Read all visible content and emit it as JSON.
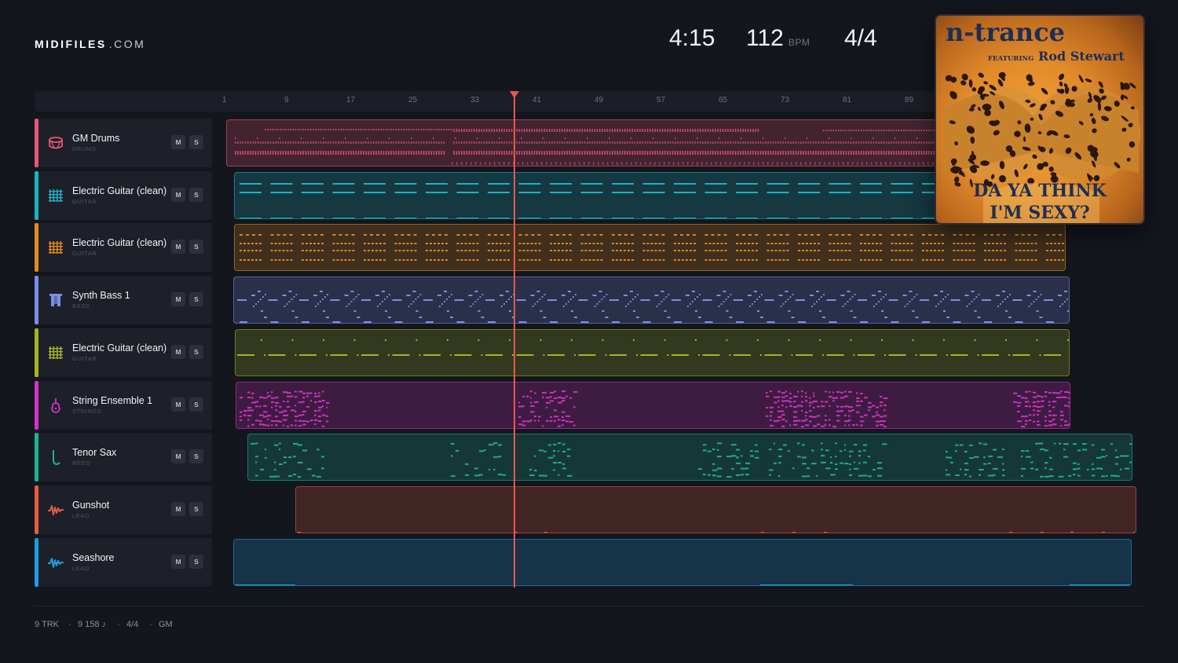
{
  "brand": {
    "name": "MIDIFILES",
    "tld": ".COM"
  },
  "stats": {
    "duration": "4:15",
    "tempo": "112",
    "tempo_unit": "BPM",
    "time_signature": "4/4"
  },
  "album": {
    "artist": "n-trance",
    "featuring_prefix": "FEATURING",
    "featuring_artist": "Rod Stewart",
    "title_line1": "DA YA THINK",
    "title_line2": "I'M SEXY?"
  },
  "ruler": {
    "ticks": [
      "1",
      "9",
      "17",
      "25",
      "33",
      "41",
      "49",
      "57",
      "65",
      "73",
      "81",
      "89"
    ]
  },
  "tracks": [
    {
      "name": "GM Drums",
      "category": "DRUMS",
      "mute": "M",
      "solo": "S",
      "color": "#e8557a",
      "icon": "drum-icon",
      "pattern": "drums",
      "lane_start": 288,
      "lane_end": 1195
    },
    {
      "name": "Electric Guitar (clean)",
      "category": "GUITAR",
      "mute": "M",
      "solo": "S",
      "color": "#1ab3c6",
      "icon": "guitar-icon",
      "pattern": "guitar1",
      "lane_start": 298,
      "lane_end": 1195
    },
    {
      "name": "Electric Guitar (clean)",
      "category": "GUITAR",
      "mute": "M",
      "solo": "S",
      "color": "#e48a1e",
      "icon": "guitar-icon",
      "pattern": "guitar2",
      "lane_start": 298,
      "lane_end": 1357
    },
    {
      "name": "Synth Bass 1",
      "category": "BASS",
      "mute": "M",
      "solo": "S",
      "color": "#7a8ee8",
      "icon": "bass-icon",
      "pattern": "bass",
      "lane_start": 297,
      "lane_end": 1362
    },
    {
      "name": "Electric Guitar (clean)",
      "category": "GUITAR",
      "mute": "M",
      "solo": "S",
      "color": "#a4b523",
      "icon": "guitar-icon",
      "pattern": "guitar3",
      "lane_start": 299,
      "lane_end": 1362
    },
    {
      "name": "String Ensemble 1",
      "category": "STRINGS",
      "mute": "M",
      "solo": "S",
      "color": "#d433c8",
      "icon": "violin-icon",
      "pattern": "strings",
      "lane_start": 300,
      "lane_end": 1363
    },
    {
      "name": "Tenor Sax",
      "category": "REED",
      "mute": "M",
      "solo": "S",
      "color": "#1cb294",
      "icon": "sax-icon",
      "pattern": "sax",
      "lane_start": 315,
      "lane_end": 1442
    },
    {
      "name": "Gunshot",
      "category": "LEAD",
      "mute": "M",
      "solo": "S",
      "color": "#e55a45",
      "icon": "wave-icon",
      "pattern": "gunshot",
      "lane_start": 376,
      "lane_end": 1447
    },
    {
      "name": "Seashore",
      "category": "LEAD",
      "mute": "M",
      "solo": "S",
      "color": "#1e9ce0",
      "icon": "wave-icon",
      "pattern": "seashore",
      "lane_start": 297,
      "lane_end": 1441
    }
  ],
  "footer": {
    "tracks": "9 TRK",
    "notes": "9 158 ♪",
    "time_signature": "4/4",
    "standard": "GM"
  }
}
